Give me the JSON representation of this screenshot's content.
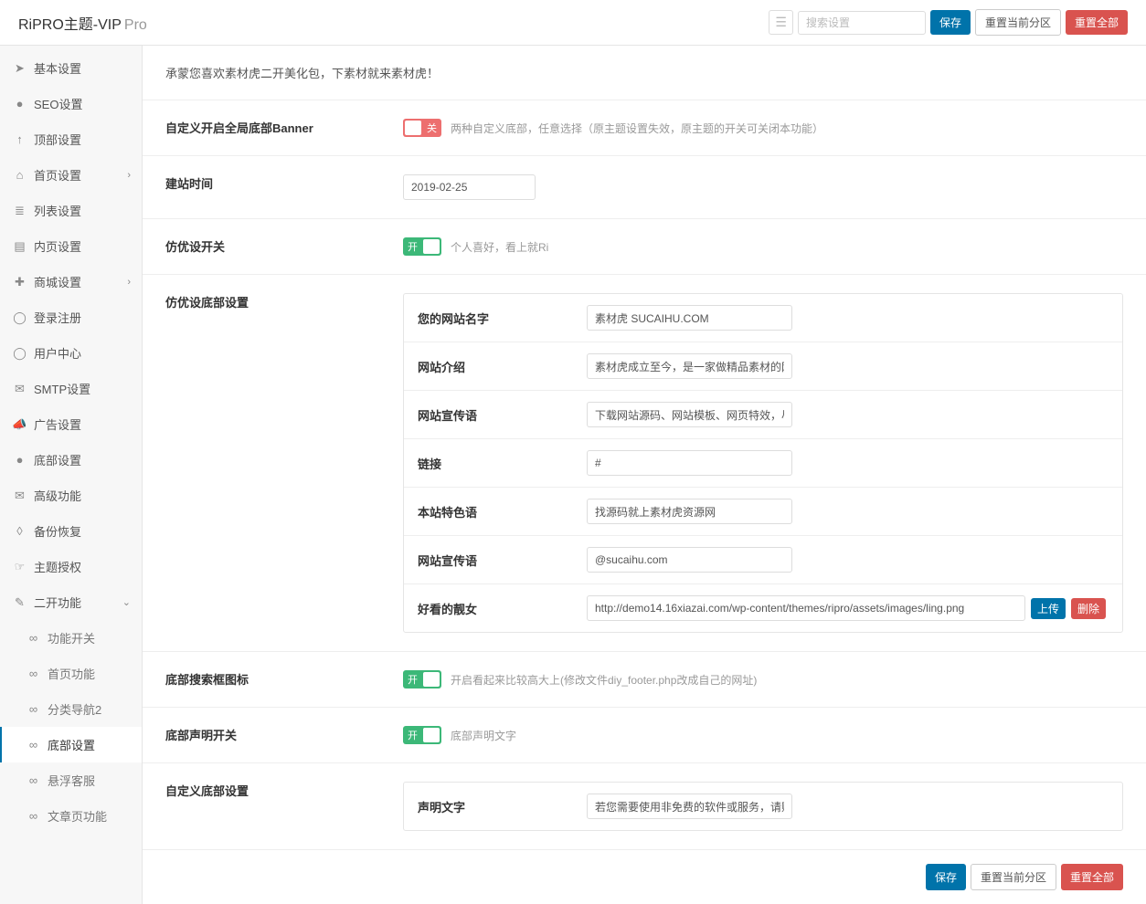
{
  "header": {
    "brand": "RiPRO主题-VIP",
    "brand_sub": "Pro",
    "search_placeholder": "搜索设置",
    "save": "保存",
    "reset_section": "重置当前分区",
    "reset_all": "重置全部"
  },
  "sidebar": {
    "items": [
      {
        "icon": "paper-plane",
        "label": "基本设置"
      },
      {
        "icon": "circle",
        "label": "SEO设置"
      },
      {
        "icon": "arrow-up",
        "label": "顶部设置"
      },
      {
        "icon": "home",
        "label": "首页设置",
        "expand": true
      },
      {
        "icon": "list",
        "label": "列表设置"
      },
      {
        "icon": "file",
        "label": "内页设置"
      },
      {
        "icon": "plus-circle",
        "label": "商城设置",
        "expand": true
      },
      {
        "icon": "user",
        "label": "登录注册"
      },
      {
        "icon": "user",
        "label": "用户中心"
      },
      {
        "icon": "envelope",
        "label": "SMTP设置"
      },
      {
        "icon": "bullhorn",
        "label": "广告设置"
      },
      {
        "icon": "circle",
        "label": "底部设置"
      },
      {
        "icon": "envelope",
        "label": "高级功能"
      },
      {
        "icon": "shield",
        "label": "备份恢复"
      },
      {
        "icon": "hand",
        "label": "主题授权"
      },
      {
        "icon": "wrench",
        "label": "二开功能",
        "expand": true,
        "open": true
      },
      {
        "icon": "link",
        "label": "功能开关",
        "child": true
      },
      {
        "icon": "link",
        "label": "首页功能",
        "child": true
      },
      {
        "icon": "link",
        "label": "分类导航2",
        "child": true
      },
      {
        "icon": "link",
        "label": "底部设置",
        "child": true,
        "active": true
      },
      {
        "icon": "link",
        "label": "悬浮客服",
        "child": true
      },
      {
        "icon": "link",
        "label": "文章页功能",
        "child": true
      }
    ]
  },
  "sections": {
    "intro": "承蒙您喜欢素材虎二开美化包，下素材就来素材虎！",
    "banner": {
      "label": "自定义开启全局底部Banner",
      "toggle": "off",
      "toggle_text": "关",
      "hint": "两种自定义底部，任意选择（原主题设置失效，原主题的开关可关闭本功能）"
    },
    "build_time": {
      "label": "建站时间",
      "value": "2019-02-25"
    },
    "fangyou_switch": {
      "label": "仿优设开关",
      "toggle": "on",
      "toggle_text": "开",
      "hint": "个人喜好，看上就Ri"
    },
    "fangyou_panel": {
      "label": "仿优设底部设置",
      "rows": [
        {
          "label": "您的网站名字",
          "value": "素材虎 SUCAIHU.COM"
        },
        {
          "label": "网站介绍",
          "value": "素材虎成立至今，是一家做精品素材的网!"
        },
        {
          "label": "网站宣传语",
          "value": "下载网站源码、网站模板、网页特效，尽!"
        },
        {
          "label": "链接",
          "value": "#"
        },
        {
          "label": "本站特色语",
          "value": "找源码就上素材虎资源网"
        },
        {
          "label": "网站宣传语",
          "value": "@sucaihu.com"
        },
        {
          "label": "好看的靓女",
          "value": "http://demo14.16xiazai.com/wp-content/themes/ripro/assets/images/ling.png",
          "upload": true
        }
      ],
      "upload_btn": "上传",
      "delete_btn": "删除"
    },
    "search_icon": {
      "label": "底部搜索框图标",
      "toggle": "on",
      "toggle_text": "开",
      "hint": "开启看起来比较高大上(修改文件diy_footer.php改成自己的网址)"
    },
    "statement_switch": {
      "label": "底部声明开关",
      "toggle": "on",
      "toggle_text": "开",
      "hint": "底部声明文字"
    },
    "custom_footer": {
      "label": "自定义底部设置",
      "rows": [
        {
          "label": "声明文字",
          "value": "若您需要使用非免费的软件或服务，请购!"
        }
      ]
    }
  }
}
